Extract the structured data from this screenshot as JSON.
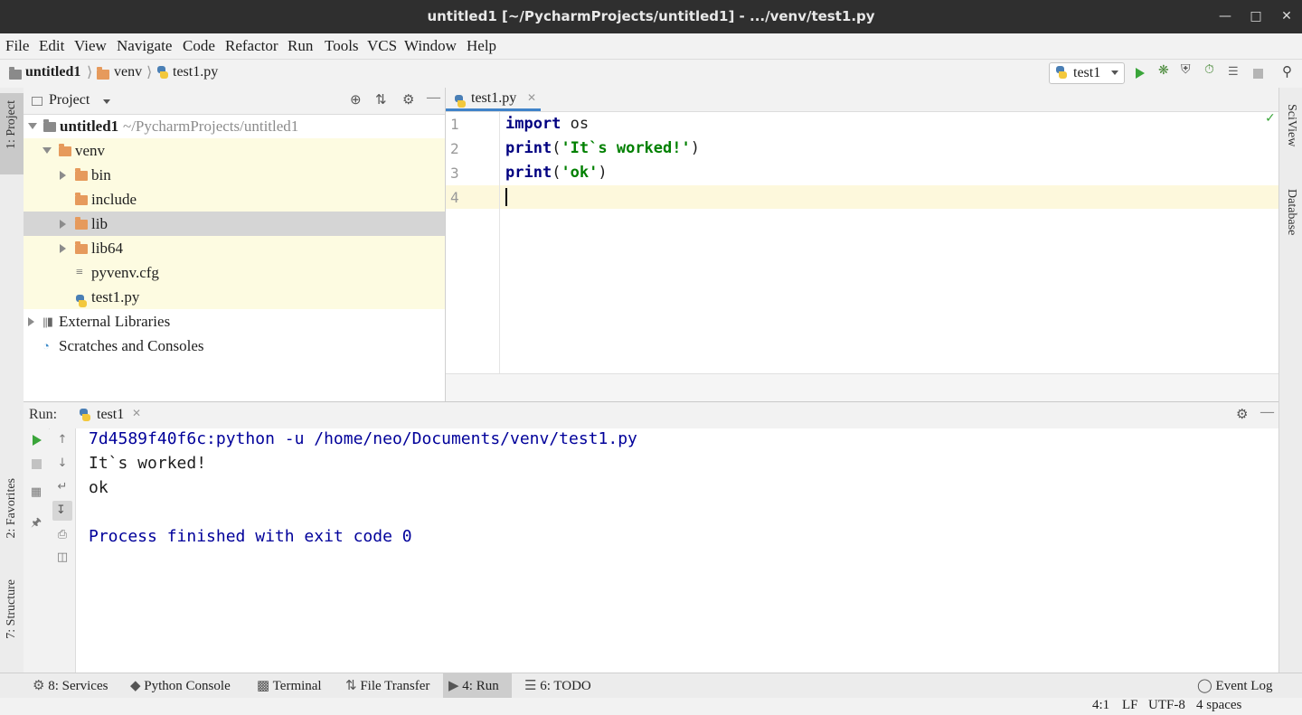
{
  "window": {
    "title": "untitled1 [~/PycharmProjects/untitled1] - .../venv/test1.py",
    "controls": [
      "minimize",
      "maximize",
      "close"
    ]
  },
  "menu": [
    "File",
    "Edit",
    "View",
    "Navigate",
    "Code",
    "Refactor",
    "Run",
    "Tools",
    "VCS",
    "Window",
    "Help"
  ],
  "breadcrumb": [
    "untitled1",
    "venv",
    "test1.py"
  ],
  "run_config": {
    "name": "test1"
  },
  "left_strip": {
    "project": "1: Project",
    "favorites": "2: Favorites",
    "structure": "7: Structure"
  },
  "right_strip": {
    "sciview": "SciView",
    "database": "Database"
  },
  "project": {
    "header": "Project",
    "root": {
      "name": "untitled1",
      "path": "~/PycharmProjects/untitled1"
    },
    "items": [
      {
        "name": "venv"
      },
      {
        "name": "bin"
      },
      {
        "name": "include"
      },
      {
        "name": "lib"
      },
      {
        "name": "lib64"
      },
      {
        "name": "pyvenv.cfg"
      },
      {
        "name": "test1.py"
      },
      {
        "name": "External Libraries"
      },
      {
        "name": "Scratches and Consoles"
      }
    ]
  },
  "editor": {
    "tab": "test1.py",
    "line_numbers": [
      "1",
      "2",
      "3",
      "4"
    ],
    "lines": [
      {
        "kw": "import",
        "rest": " os"
      },
      {
        "kw": "print",
        "open": "(",
        "str": "'It`s worked!'",
        "close": ")"
      },
      {
        "kw": "print",
        "open": "(",
        "str": "'ok'",
        "close": ")"
      }
    ]
  },
  "run": {
    "label": "Run:",
    "tab": "test1",
    "console": [
      "7d4589f40f6c:python -u /home/neo/Documents/venv/test1.py",
      "It`s worked!",
      "ok",
      "",
      "Process finished with exit code 0"
    ]
  },
  "toolwindows": [
    {
      "key": "8",
      "label": "8: Services"
    },
    {
      "label": "Python Console"
    },
    {
      "label": "Terminal"
    },
    {
      "label": "File Transfer"
    },
    {
      "label": "4: Run"
    },
    {
      "label": "6: TODO"
    },
    {
      "label": "Event Log"
    }
  ],
  "status": {
    "position": "4:1",
    "line_sep": "LF",
    "encoding": "UTF-8",
    "indent": "4 spaces"
  },
  "colors": {
    "accent": "#4083c9",
    "keyword": "#000080",
    "string": "#008000",
    "console_blue": "#00009a",
    "venv_bg": "#fdfbe1"
  }
}
